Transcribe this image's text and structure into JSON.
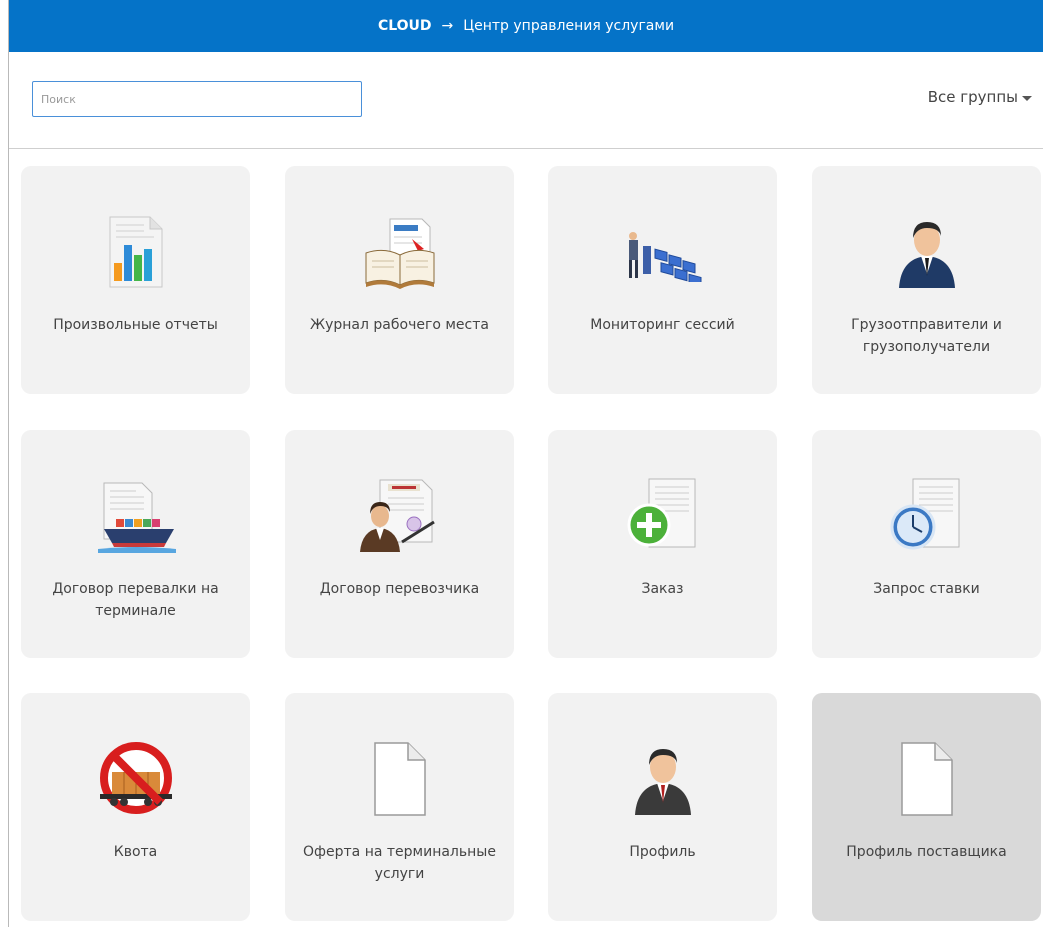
{
  "header": {
    "brand": "CLOUD",
    "arrow": "→",
    "title": "Центр управления услугами"
  },
  "search": {
    "placeholder": "Поиск",
    "value": ""
  },
  "groups": {
    "label": "Все группы"
  },
  "tiles": [
    {
      "label": "Произвольные отчеты",
      "icon": "report-chart-icon"
    },
    {
      "label": "Журнал рабочего места",
      "icon": "journal-book-icon"
    },
    {
      "label": "Мониторинг сессий",
      "icon": "session-monitoring-icon"
    },
    {
      "label": "Грузоотправители и грузополучатели",
      "icon": "businessman-icon"
    },
    {
      "label": "Договор перевалки на терминале",
      "icon": "ship-contract-icon"
    },
    {
      "label": "Договор перевозчика",
      "icon": "carrier-contract-icon"
    },
    {
      "label": "Заказ",
      "icon": "order-add-icon"
    },
    {
      "label": "Запрос ставки",
      "icon": "rate-request-clock-icon"
    },
    {
      "label": "Квота",
      "icon": "quota-prohibited-wagon-icon"
    },
    {
      "label": "Оферта на терминальные услуги",
      "icon": "blank-document-icon"
    },
    {
      "label": "Профиль",
      "icon": "profile-person-icon"
    },
    {
      "label": "Профиль поставщика",
      "icon": "blank-document-icon"
    }
  ],
  "colors": {
    "header_bg": "#0573c8",
    "tile_bg": "#f2f2f2",
    "tile_selected_bg": "#d9d9d9"
  }
}
